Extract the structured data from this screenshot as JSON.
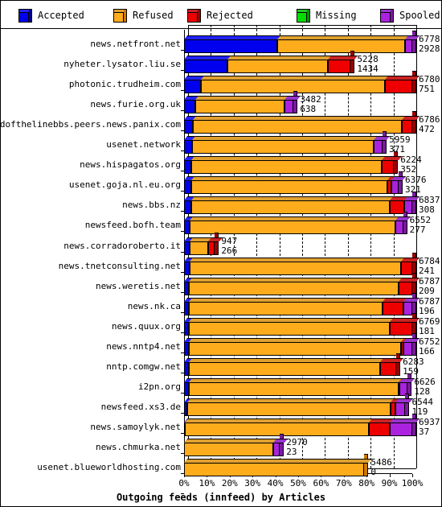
{
  "legend": {
    "items": [
      {
        "label": "Accepted",
        "color": "#0000ee",
        "icon": "cube-icon"
      },
      {
        "label": "Refused",
        "color": "#ffac1c",
        "icon": "cube-icon"
      },
      {
        "label": "Rejected",
        "color": "#ee0000",
        "icon": "cube-icon"
      },
      {
        "label": "Missing",
        "color": "#00dd00",
        "icon": "cube-icon"
      },
      {
        "label": "Spooled",
        "color": "#aa22dd",
        "icon": "cube-icon"
      }
    ]
  },
  "chart_data": {
    "type": "bar",
    "orientation": "horizontal",
    "stacked": true,
    "percent_stacked": true,
    "title": "Outgoing feeds (innfeed) by Articles",
    "xlabel": "Outgoing feeds (innfeed) by Articles",
    "ylabel": "",
    "xlim": [
      0,
      100
    ],
    "xticks": [
      0,
      10,
      20,
      30,
      40,
      50,
      60,
      70,
      80,
      90,
      100
    ],
    "xtick_labels": [
      "0%",
      "10%",
      "20%",
      "30%",
      "40%",
      "50%",
      "60%",
      "70%",
      "80%",
      "90%",
      "100%"
    ],
    "grid": true,
    "grid_axis": "x",
    "legend_position": "top",
    "series_names": [
      "Accepted",
      "Refused",
      "Rejected",
      "Missing",
      "Spooled"
    ],
    "series_colors": [
      "#0000ee",
      "#ffac1c",
      "#ee0000",
      "#00dd00",
      "#aa22dd"
    ],
    "categories": [
      "news.netfront.net",
      "nyheter.lysator.liu.se",
      "photonic.trudheim.com",
      "news.furie.org.uk",
      "endofthelinebbs.peers.news.panix.com",
      "usenet.network",
      "news.hispagatos.org",
      "usenet.goja.nl.eu.org",
      "news.bbs.nz",
      "newsfeed.bofh.team",
      "news.corradoroberto.it",
      "news.tnetconsulting.net",
      "news.weretis.net",
      "news.nk.ca",
      "news.quux.org",
      "news.nntp4.net",
      "nntp.comgw.net",
      "i2pn.org",
      "newsfeed.xs3.de",
      "news.samoylyk.net",
      "news.chmurka.net",
      "usenet.blueworldhosting.com"
    ],
    "rows": [
      {
        "category": "news.netfront.net",
        "value_top": "6778",
        "value_bottom": "2928",
        "total_pct": 100.0,
        "pct": {
          "accepted": 41.0,
          "refused": 56.0,
          "rejected": 0.0,
          "missing": 0.0,
          "spooled": 3.0
        }
      },
      {
        "category": "nyheter.lysator.liu.se",
        "value_top": "5228",
        "value_bottom": "1434",
        "total_pct": 73.0,
        "pct": {
          "accepted": 19.0,
          "refused": 44.0,
          "rejected": 10.0,
          "missing": 0.0,
          "spooled": 0.0
        }
      },
      {
        "category": "photonic.trudheim.com",
        "value_top": "6780",
        "value_bottom": "751",
        "total_pct": 100.0,
        "pct": {
          "accepted": 7.5,
          "refused": 80.5,
          "rejected": 12.0,
          "missing": 0.0,
          "spooled": 0.0
        }
      },
      {
        "category": "news.furie.org.uk",
        "value_top": "3482",
        "value_bottom": "638",
        "total_pct": 48.0,
        "pct": {
          "accepted": 5.0,
          "refused": 39.0,
          "rejected": 0.0,
          "missing": 0.0,
          "spooled": 4.0
        }
      },
      {
        "category": "endofthelinebbs.peers.news.panix.com",
        "value_top": "6786",
        "value_bottom": "472",
        "total_pct": 100.0,
        "pct": {
          "accepted": 4.0,
          "refused": 91.5,
          "rejected": 4.5,
          "missing": 0.0,
          "spooled": 0.0
        }
      },
      {
        "category": "usenet.network",
        "value_top": "5959",
        "value_bottom": "371",
        "total_pct": 87.0,
        "pct": {
          "accepted": 3.5,
          "refused": 79.5,
          "rejected": 0.0,
          "missing": 0.0,
          "spooled": 4.0
        }
      },
      {
        "category": "news.hispagatos.org",
        "value_top": "6224",
        "value_bottom": "352",
        "total_pct": 92.0,
        "pct": {
          "accepted": 3.0,
          "refused": 83.5,
          "rejected": 5.5,
          "missing": 0.0,
          "spooled": 0.0
        }
      },
      {
        "category": "usenet.goja.nl.eu.org",
        "value_top": "6376",
        "value_bottom": "321",
        "total_pct": 94.0,
        "pct": {
          "accepted": 3.0,
          "refused": 86.0,
          "rejected": 2.0,
          "missing": 0.0,
          "spooled": 3.0
        }
      },
      {
        "category": "news.bbs.nz",
        "value_top": "6837",
        "value_bottom": "308",
        "total_pct": 100.0,
        "pct": {
          "accepted": 3.0,
          "refused": 87.0,
          "rejected": 6.5,
          "missing": 0.0,
          "spooled": 3.5
        }
      },
      {
        "category": "newsfeed.bofh.team",
        "value_top": "6552",
        "value_bottom": "277",
        "total_pct": 96.0,
        "pct": {
          "accepted": 2.5,
          "refused": 90.0,
          "rejected": 0.0,
          "missing": 0.0,
          "spooled": 3.5
        }
      },
      {
        "category": "news.corradoroberto.it",
        "value_top": "947",
        "value_bottom": "266",
        "total_pct": 13.5,
        "pct": {
          "accepted": 2.5,
          "refused": 8.0,
          "rejected": 3.0,
          "missing": 0.0,
          "spooled": 0.0
        }
      },
      {
        "category": "news.tnetconsulting.net",
        "value_top": "6784",
        "value_bottom": "241",
        "total_pct": 100.0,
        "pct": {
          "accepted": 2.5,
          "refused": 92.5,
          "rejected": 5.0,
          "missing": 0.0,
          "spooled": 0.0
        }
      },
      {
        "category": "news.weretis.net",
        "value_top": "6787",
        "value_bottom": "209",
        "total_pct": 100.0,
        "pct": {
          "accepted": 2.0,
          "refused": 92.0,
          "rejected": 6.0,
          "missing": 0.0,
          "spooled": 0.0
        }
      },
      {
        "category": "news.nk.ca",
        "value_top": "6787",
        "value_bottom": "196",
        "total_pct": 100.0,
        "pct": {
          "accepted": 2.0,
          "refused": 85.0,
          "rejected": 9.0,
          "missing": 0.0,
          "spooled": 4.0
        }
      },
      {
        "category": "news.quux.org",
        "value_top": "6769",
        "value_bottom": "181",
        "total_pct": 100.0,
        "pct": {
          "accepted": 2.0,
          "refused": 88.0,
          "rejected": 10.0,
          "missing": 0.0,
          "spooled": 0.0
        }
      },
      {
        "category": "news.nntp4.net",
        "value_top": "6752",
        "value_bottom": "166",
        "total_pct": 100.0,
        "pct": {
          "accepted": 2.0,
          "refused": 93.0,
          "rejected": 1.0,
          "missing": 0.0,
          "spooled": 4.0
        }
      },
      {
        "category": "nntp.comgw.net",
        "value_top": "6283",
        "value_bottom": "159",
        "total_pct": 93.0,
        "pct": {
          "accepted": 2.0,
          "refused": 84.0,
          "rejected": 7.0,
          "missing": 0.0,
          "spooled": 0.0
        }
      },
      {
        "category": "i2pn.org",
        "value_top": "6626",
        "value_bottom": "128",
        "total_pct": 98.0,
        "pct": {
          "accepted": 2.0,
          "refused": 92.0,
          "rejected": 0.5,
          "missing": 0.0,
          "spooled": 3.5
        }
      },
      {
        "category": "newsfeed.xs3.de",
        "value_top": "6544",
        "value_bottom": "119",
        "total_pct": 97.0,
        "pct": {
          "accepted": 1.5,
          "refused": 89.0,
          "rejected": 2.0,
          "missing": 0.0,
          "spooled": 4.5
        }
      },
      {
        "category": "news.samoylyk.net",
        "value_top": "6937",
        "value_bottom": "37",
        "total_pct": 100.0,
        "pct": {
          "accepted": 0.5,
          "refused": 80.5,
          "rejected": 9.0,
          "missing": 0.0,
          "spooled": 10.0
        }
      },
      {
        "category": "news.chmurka.net",
        "value_top": "2970",
        "value_bottom": "23",
        "total_pct": 42.0,
        "pct": {
          "accepted": 0.0,
          "refused": 39.0,
          "rejected": 0.0,
          "missing": 0.0,
          "spooled": 3.0
        }
      },
      {
        "category": "usenet.blueworldhosting.com",
        "value_top": "5486",
        "value_bottom": "0",
        "total_pct": 79.0,
        "pct": {
          "accepted": 0.0,
          "refused": 79.0,
          "rejected": 0.0,
          "missing": 0.0,
          "spooled": 0.0
        }
      }
    ]
  }
}
